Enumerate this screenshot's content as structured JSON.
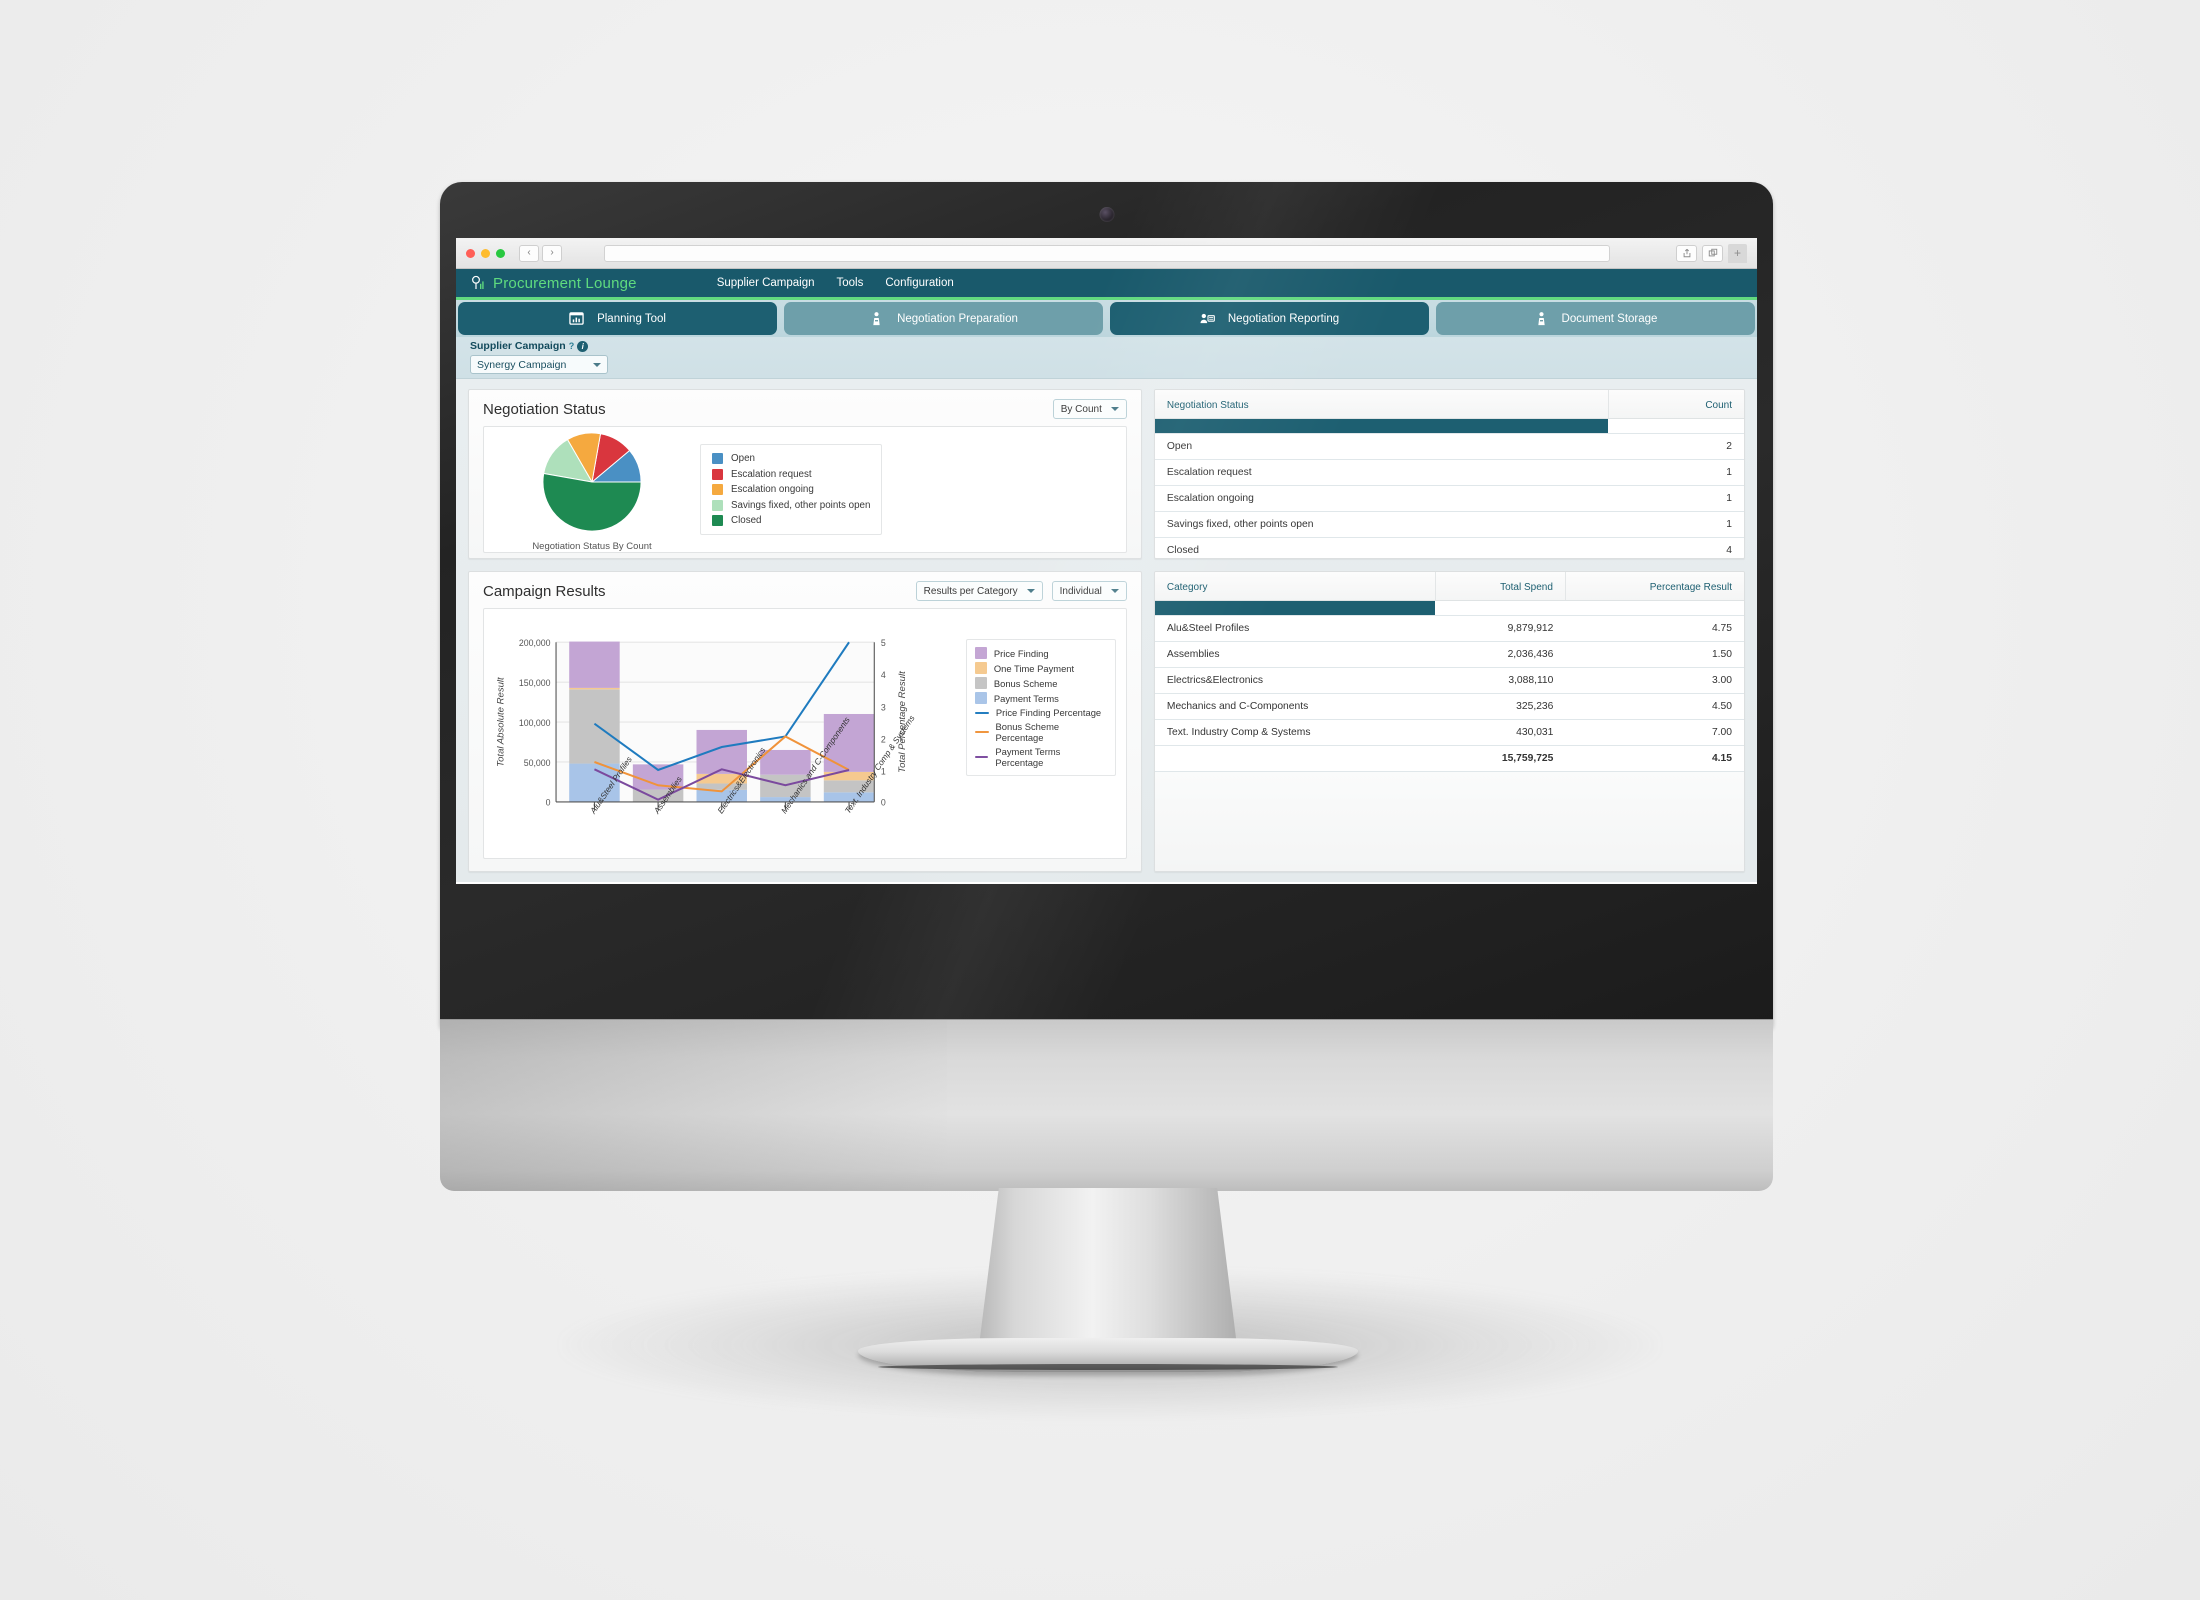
{
  "browser": {
    "back_label": "‹",
    "forward_label": "›",
    "url_value": "",
    "url_placeholder": "",
    "newtab_label": "+"
  },
  "app": {
    "brand": "Procurement Lounge",
    "topnav": [
      "Supplier Campaign",
      "Tools",
      "Configuration"
    ],
    "accent_green": "#5fdb7f",
    "accent_teal": "#1d5f71",
    "tabs": [
      {
        "label": "Planning Tool",
        "icon": "chart-window-icon",
        "active": true
      },
      {
        "label": "Negotiation Preparation",
        "icon": "person-podium-icon",
        "active": false
      },
      {
        "label": "Negotiation Reporting",
        "icon": "person-card-icon",
        "active": true
      },
      {
        "label": "Document Storage",
        "icon": "person-podium-icon",
        "active": false
      }
    ],
    "subbar": {
      "label": "Supplier Campaign",
      "help_marker": "?",
      "info_marker": "i",
      "select_value": "Synergy Campaign"
    }
  },
  "negotiation_status": {
    "title": "Negotiation Status",
    "control": "By Count",
    "caption": "Negotiation Status By Count",
    "legend": [
      {
        "label": "Open",
        "color": "#4a90c4"
      },
      {
        "label": "Escalation request",
        "color": "#d9363e"
      },
      {
        "label": "Escalation ongoing",
        "color": "#f5a93f"
      },
      {
        "label": "Savings fixed, other points open",
        "color": "#aee0bb"
      },
      {
        "label": "Closed",
        "color": "#1e8a52"
      }
    ]
  },
  "status_table": {
    "headers": [
      "Negotiation Status",
      "Count"
    ],
    "rows": [
      {
        "status": "Open",
        "count": "2"
      },
      {
        "status": "Escalation request",
        "count": "1"
      },
      {
        "status": "Escalation ongoing",
        "count": "1"
      },
      {
        "status": "Savings fixed, other points open",
        "count": "1"
      },
      {
        "status": "Closed",
        "count": "4"
      }
    ]
  },
  "campaign_results": {
    "title": "Campaign Results",
    "control_left": "Results per Category",
    "control_right": "Individual"
  },
  "category_table": {
    "headers": [
      "Category",
      "Total Spend",
      "Percentage Result"
    ],
    "rows": [
      {
        "category": "Alu&Steel Profiles",
        "spend": "9,879,912",
        "pct": "4.75"
      },
      {
        "category": "Assemblies",
        "spend": "2,036,436",
        "pct": "1.50"
      },
      {
        "category": "Electrics&Electronics",
        "spend": "3,088,110",
        "pct": "3.00"
      },
      {
        "category": "Mechanics and C-Components",
        "spend": "325,236",
        "pct": "4.50"
      },
      {
        "category": "Text. Industry Comp & Systems",
        "spend": "430,031",
        "pct": "7.00"
      }
    ],
    "total": {
      "category": "",
      "spend": "15,759,725",
      "pct": "4.15"
    }
  },
  "chart_data": [
    {
      "type": "pie",
      "title": "Negotiation Status By Count",
      "labels": [
        "Open",
        "Escalation request",
        "Escalation ongoing",
        "Savings fixed, other points open",
        "Closed"
      ],
      "values": [
        2,
        1,
        1,
        1,
        4
      ],
      "colors": [
        "#4a90c4",
        "#d9363e",
        "#f5a93f",
        "#aee0bb",
        "#1e8a52"
      ],
      "legend_position": "right"
    },
    {
      "type": "bar",
      "title": "Campaign Results",
      "xlabel": "",
      "ylabel": "Total Absolute Result",
      "y2label": "Total Percentage Result",
      "ylim": [
        0,
        200000
      ],
      "y2lim": [
        0,
        5
      ],
      "yticks": [
        "0",
        "50,000",
        "100,000",
        "150,000",
        "200,000"
      ],
      "y2ticks": [
        "0",
        "1",
        "2",
        "3",
        "4",
        "5"
      ],
      "grid": true,
      "categories": [
        "Alu&Steel Profiles",
        "Assemblies",
        "Electrics&Electronics",
        "Mechanics and C-Components",
        "Text. Industry Comp & Systems"
      ],
      "stacked": true,
      "series": [
        {
          "name": "Payment Terms",
          "type": "bar",
          "color": "#a8c4e8",
          "values": [
            48000,
            0,
            15000,
            6000,
            12000
          ]
        },
        {
          "name": "Bonus Scheme",
          "type": "bar",
          "color": "#c4c4c4",
          "values": [
            93000,
            15500,
            8000,
            28000,
            15000
          ]
        },
        {
          "name": "One Time Payment",
          "type": "bar",
          "color": "#f5c98f",
          "values": [
            1800,
            0,
            12000,
            0,
            10500
          ]
        },
        {
          "name": "Price Finding",
          "type": "bar",
          "color": "#c3a5d4",
          "values": [
            58000,
            31500,
            55000,
            31000,
            72500
          ]
        },
        {
          "name": "Price Finding Percentage",
          "type": "line",
          "color": "#1f7bbf",
          "values": [
            2.45,
            1.0,
            1.72,
            2.05,
            5.0
          ]
        },
        {
          "name": "Bonus Scheme Percentage",
          "type": "line",
          "color": "#f0933a",
          "values": [
            1.25,
            0.52,
            0.33,
            2.05,
            1.0
          ]
        },
        {
          "name": "Payment Terms Percentage",
          "type": "line",
          "color": "#7b4a9e",
          "values": [
            1.02,
            0.07,
            1.02,
            0.52,
            1.0
          ]
        }
      ],
      "legend_position": "right",
      "legend_entries": [
        "Price Finding",
        "One Time Payment",
        "Bonus Scheme",
        "Payment Terms",
        "Price Finding Percentage",
        "Bonus Scheme Percentage",
        "Payment Terms Percentage"
      ]
    }
  ]
}
